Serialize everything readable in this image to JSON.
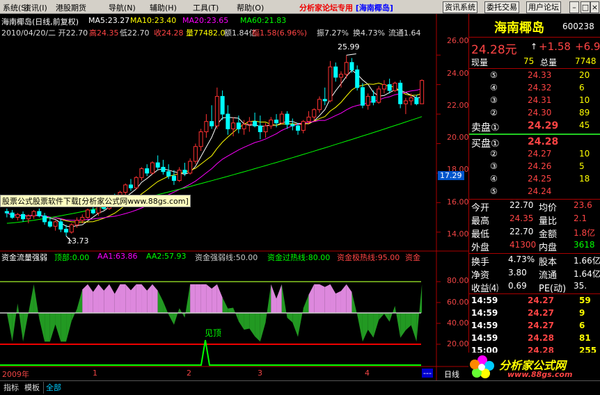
{
  "menu": {
    "items": [
      "系统(S)",
      "资讯(I)",
      "港股期货",
      "导航(N)",
      "辅助(H)",
      "工具(T)",
      "帮助(O)"
    ],
    "center_text": "分析家论坛专用",
    "center_link": "[海南椰岛]",
    "buttons": [
      "资讯系统",
      "委托交易",
      "用户论坛"
    ]
  },
  "info": {
    "line1_name": "海南椰岛(日线,前复权)",
    "ma5": "MA5:23.27",
    "ma10": "MA10:23.40",
    "ma20": "MA20:23.65",
    "ma60": "MA60:21.83",
    "line2_date": "2010/04/20/二 开22.70",
    "high": "高24.35",
    "low": "低22.70",
    "close": "收24.28",
    "vol": "量77482.0",
    "amt": "额1.84亿",
    "chg": "幅1.58(6.96%)",
    "amp": "振7.27%",
    "turnover": "换4.73%",
    "float": "流通1.64"
  },
  "colors": {
    "ma5": "#ffffff",
    "ma10": "#ffff00",
    "ma20": "#ff00ff",
    "ma60": "#00ff00",
    "up": "#ff3232",
    "down": "#00ffff",
    "green_band": "#229922",
    "pink_band": "#dd88dd"
  },
  "price_axis": {
    "labels": [
      "26.00",
      "24.00",
      "22.00",
      "20.00",
      "18.00",
      "16.00",
      "14.00"
    ],
    "current_price_tag": "17.29",
    "high_marker": "25.99",
    "low_marker": "13.73"
  },
  "overlay_text": "股票公式股票软件下载[分析家公式网www.88gs.com]",
  "indicator": {
    "name": "资金流量强弱",
    "top": "顶部:0.00",
    "aa1": "AA1:63.86",
    "aa2": "AA2:57.93",
    "weak": "资金强弱线:50.00",
    "hot": "资金过热线:80.00",
    "overheat": "资金极热线:95.00",
    "cut": "资金",
    "axis": [
      "80.00",
      "60.00",
      "40.00",
      "20.00"
    ],
    "top_label": "见顶"
  },
  "time_axis": {
    "labels": [
      "2009年",
      "1",
      "2",
      "3",
      "4"
    ],
    "dots": "---",
    "right_label": "日线"
  },
  "quote": {
    "name": "海南椰岛",
    "code": "600238",
    "price": "24.28元",
    "change": "+1.58",
    "change_short": "+6.9",
    "now_vol_label": "现量",
    "now_vol": "75",
    "total_label": "总量",
    "total": "7748",
    "sell": [
      {
        "n": "⑤",
        "p": "24.33",
        "v": "20"
      },
      {
        "n": "④",
        "p": "24.32",
        "v": "6"
      },
      {
        "n": "③",
        "p": "24.31",
        "v": "10"
      },
      {
        "n": "②",
        "p": "24.30",
        "v": "89"
      },
      {
        "n": "卖盘①",
        "p": "24.29",
        "v": "45"
      }
    ],
    "buy": [
      {
        "n": "买盘①",
        "p": "24.28",
        "v": ""
      },
      {
        "n": "②",
        "p": "24.27",
        "v": "10"
      },
      {
        "n": "③",
        "p": "24.26",
        "v": "5"
      },
      {
        "n": "④",
        "p": "24.25",
        "v": "18"
      },
      {
        "n": "⑤",
        "p": "24.24",
        "v": ""
      }
    ],
    "stats": [
      {
        "a": "今开",
        "av": "22.70",
        "b": "均价",
        "bv": "23.6"
      },
      {
        "a": "最高",
        "av": "24.35",
        "b": "量比",
        "bv": "2.1"
      },
      {
        "a": "最低",
        "av": "22.70",
        "b": "金额",
        "bv": "1.8亿"
      },
      {
        "a": "外盘",
        "av": "41300",
        "b": "内盘",
        "bv": "3618"
      }
    ],
    "stats2": [
      {
        "a": "换手",
        "av": "4.73%",
        "b": "股本",
        "bv": "1.66亿"
      },
      {
        "a": "净资",
        "av": "3.80",
        "b": "流通",
        "bv": "1.64亿"
      },
      {
        "a": "收益⑷",
        "av": "0.69",
        "b": "PE(动)",
        "bv": "35."
      }
    ],
    "ticks": [
      {
        "t": "14:59",
        "p": "24.27",
        "v": "59"
      },
      {
        "t": "14:59",
        "p": "24.27",
        "v": "9"
      },
      {
        "t": "14:59",
        "p": "24.27",
        "v": "6"
      },
      {
        "t": "14:59",
        "p": "24.28",
        "v": "81"
      },
      {
        "t": "15:00",
        "p": "24.28",
        "v": "255"
      }
    ]
  },
  "bottom_tabs": [
    "指标",
    "模板",
    "全部"
  ],
  "logo": {
    "title": "分析家公式网",
    "url": "www.88gs.com"
  },
  "chart_data": {
    "type": "candlestick",
    "ylim": [
      13.0,
      27.0
    ],
    "candles": [
      [
        15.4,
        15.6,
        15.0,
        15.3
      ],
      [
        15.3,
        15.5,
        14.9,
        15.0
      ],
      [
        15.0,
        15.3,
        14.8,
        15.2
      ],
      [
        15.2,
        15.4,
        14.7,
        14.9
      ],
      [
        14.9,
        15.2,
        14.6,
        15.1
      ],
      [
        15.1,
        15.5,
        14.9,
        15.4
      ],
      [
        15.4,
        15.6,
        15.0,
        15.1
      ],
      [
        15.1,
        15.3,
        14.5,
        14.7
      ],
      [
        14.7,
        15.0,
        14.3,
        14.4
      ],
      [
        14.4,
        14.8,
        14.1,
        14.7
      ],
      [
        14.7,
        14.9,
        14.0,
        14.2
      ],
      [
        14.2,
        14.5,
        13.73,
        14.0
      ],
      [
        14.0,
        14.6,
        13.9,
        14.5
      ],
      [
        14.5,
        15.0,
        14.3,
        14.8
      ],
      [
        14.8,
        15.2,
        14.6,
        15.0
      ],
      [
        15.0,
        15.6,
        14.9,
        15.5
      ],
      [
        15.5,
        15.8,
        15.2,
        15.3
      ],
      [
        15.3,
        15.9,
        15.1,
        15.8
      ],
      [
        15.8,
        16.2,
        15.5,
        15.6
      ],
      [
        15.6,
        16.4,
        15.5,
        16.3
      ],
      [
        16.3,
        16.6,
        15.9,
        16.0
      ],
      [
        16.0,
        16.8,
        15.9,
        16.7
      ],
      [
        16.7,
        17.3,
        16.5,
        17.2
      ],
      [
        17.2,
        17.6,
        16.8,
        17.0
      ],
      [
        17.0,
        17.8,
        16.9,
        17.7
      ],
      [
        17.7,
        18.4,
        17.5,
        18.3
      ],
      [
        18.3,
        18.6,
        17.8,
        18.0
      ],
      [
        18.0,
        18.8,
        17.9,
        18.7
      ],
      [
        18.7,
        19.2,
        18.2,
        18.4
      ],
      [
        18.4,
        18.9,
        17.9,
        18.1
      ],
      [
        18.1,
        18.6,
        17.6,
        17.8
      ],
      [
        17.8,
        18.2,
        17.2,
        17.5
      ],
      [
        17.5,
        18.4,
        17.4,
        18.2
      ],
      [
        18.2,
        18.7,
        17.8,
        18.0
      ],
      [
        18.0,
        19.0,
        17.9,
        18.8
      ],
      [
        18.8,
        20.0,
        18.6,
        19.8
      ],
      [
        19.8,
        21.0,
        19.5,
        20.8
      ],
      [
        20.8,
        22.0,
        20.4,
        21.5
      ],
      [
        21.5,
        22.6,
        21.0,
        21.2
      ],
      [
        21.2,
        23.8,
        21.0,
        23.2
      ],
      [
        23.2,
        23.6,
        21.6,
        22.0
      ],
      [
        22.0,
        22.6,
        20.6,
        21.0
      ],
      [
        21.0,
        21.8,
        20.5,
        21.4
      ],
      [
        21.4,
        21.9,
        20.7,
        21.0
      ],
      [
        21.0,
        21.6,
        20.6,
        21.3
      ],
      [
        21.3,
        21.8,
        20.8,
        21.5
      ],
      [
        21.5,
        22.1,
        21.1,
        21.2
      ],
      [
        21.2,
        21.9,
        20.3,
        20.8
      ],
      [
        20.8,
        21.4,
        20.4,
        21.2
      ],
      [
        21.2,
        21.8,
        21.0,
        21.6
      ],
      [
        21.6,
        22.0,
        21.1,
        21.4
      ],
      [
        21.4,
        22.2,
        21.3,
        22.0
      ],
      [
        22.0,
        22.2,
        21.0,
        21.3
      ],
      [
        21.3,
        21.7,
        20.9,
        21.2
      ],
      [
        21.2,
        21.4,
        20.6,
        20.9
      ],
      [
        20.9,
        21.6,
        20.7,
        21.5
      ],
      [
        21.5,
        22.2,
        21.3,
        21.8
      ],
      [
        21.8,
        22.4,
        21.5,
        22.3
      ],
      [
        22.3,
        23.2,
        22.1,
        23.0
      ],
      [
        23.0,
        23.8,
        22.6,
        22.9
      ],
      [
        22.9,
        25.6,
        22.8,
        25.2
      ],
      [
        25.2,
        25.5,
        24.2,
        24.5
      ],
      [
        24.5,
        24.9,
        23.8,
        24.7
      ],
      [
        24.7,
        25.99,
        24.4,
        25.5
      ],
      [
        25.5,
        25.8,
        24.8,
        25.0
      ],
      [
        25.0,
        25.3,
        23.6,
        23.8
      ],
      [
        23.8,
        24.1,
        22.4,
        22.6
      ],
      [
        22.6,
        23.4,
        22.3,
        23.2
      ],
      [
        23.2,
        23.6,
        22.6,
        22.8
      ],
      [
        22.8,
        23.9,
        22.7,
        23.7
      ],
      [
        23.7,
        24.3,
        23.4,
        24.0
      ],
      [
        24.0,
        24.4,
        23.4,
        23.6
      ],
      [
        23.6,
        24.2,
        23.5,
        24.1
      ],
      [
        24.1,
        24.3,
        22.4,
        22.7
      ],
      [
        22.7,
        23.1,
        22.0,
        22.9
      ],
      [
        22.9,
        23.4,
        22.6,
        23.1
      ],
      [
        23.1,
        23.3,
        22.6,
        22.7
      ],
      [
        22.7,
        24.35,
        22.7,
        24.28
      ]
    ],
    "ma60_range": [
      14.6,
      21.83
    ],
    "indicator_ylim": [
      0,
      100
    ],
    "lines": {
      "top": 80,
      "weak": 50,
      "hot": 80,
      "bottom_line": 20
    }
  }
}
